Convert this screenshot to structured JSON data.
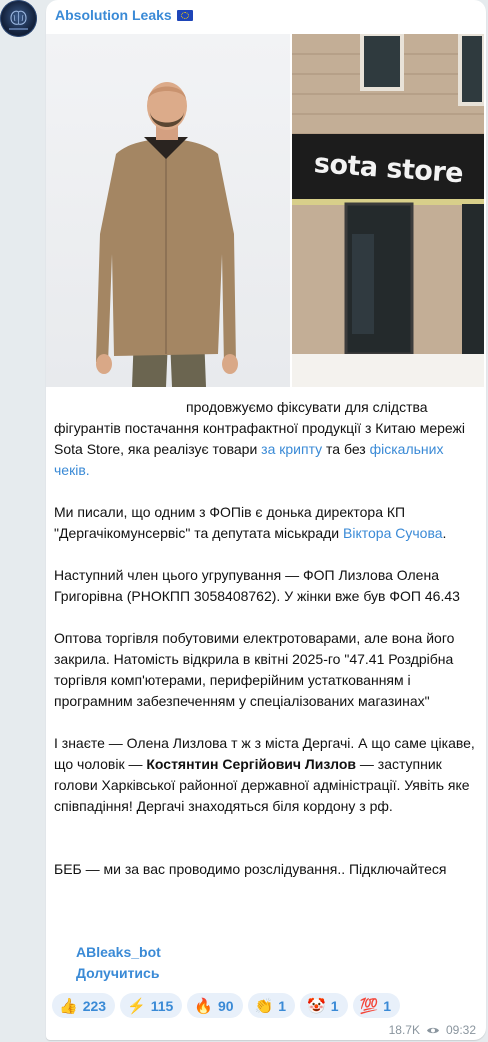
{
  "channel": {
    "name": "Absolution Leaks",
    "flag_icon": "eu-flag-icon",
    "avatar_icon": "brain-logo-icon"
  },
  "photos": {
    "left": {
      "description_icon": "man-portrait-image"
    },
    "right": {
      "sign_text": "sota store"
    }
  },
  "post": {
    "p1_pre": "продовжуємо фіксувати для слідства фігурантів постачання контрафактної продукції з Китаю мережі Sota Store, яка реалізує товари ",
    "p1_link1": "за крипту",
    "p1_mid": " та без ",
    "p1_link2": "фіскальних чеків.",
    "p2_pre": "Ми писали, що одним з ФОПів є донька директора КП \"Дергачікомунсервіс\" та депутата міськради ",
    "p2_link": "Віктора Сучова",
    "p2_post": ".",
    "p3": "Наступний член цього угрупування — ФОП Лизлова Олена Григорівна (РНОКПП 3058408762). У жінки вже був ФОП 46.43",
    "p4": "Оптова торгівля побутовими електротоварами, але вона його закрила. Натомість відкрила в квітні 2025-го \"47.41 Роздрібна торгівля комп'ютерами, периферійним устаткованням і програмним забезпеченням у спеціалізованих магазинах\"",
    "p5_pre": "І знаєте — Олена Лизлова т ж з міста Дергачі. А що саме цікаве, що чоловік — ",
    "p5_bold": "Костянтин Сергійович Лизлов",
    "p5_post": " — заступник голови Харківської районної державної адміністрації. Уявіть яке співпадіння! Дергачі знаходяться біля кордону з рф.",
    "p6": "БЕБ — ми за вас проводимо розслідування.. Підключайтеся"
  },
  "bot": {
    "handle": "ABleaks_bot",
    "action": "Долучитись"
  },
  "reactions": [
    {
      "emoji": "👍",
      "count": "223"
    },
    {
      "emoji": "⚡",
      "count": "115"
    },
    {
      "emoji": "🔥",
      "count": "90"
    },
    {
      "emoji": "👏",
      "count": "1"
    },
    {
      "emoji": "🤡",
      "count": "1"
    },
    {
      "emoji": "💯",
      "count": "1"
    }
  ],
  "meta": {
    "views": "18.7K",
    "time": "09:32",
    "views_icon": "eye-icon"
  },
  "colors": {
    "accent": "#3a8ad6",
    "background": "#e6ebee",
    "bubble": "#ffffff",
    "reaction_bg": "#e8f0fa"
  }
}
